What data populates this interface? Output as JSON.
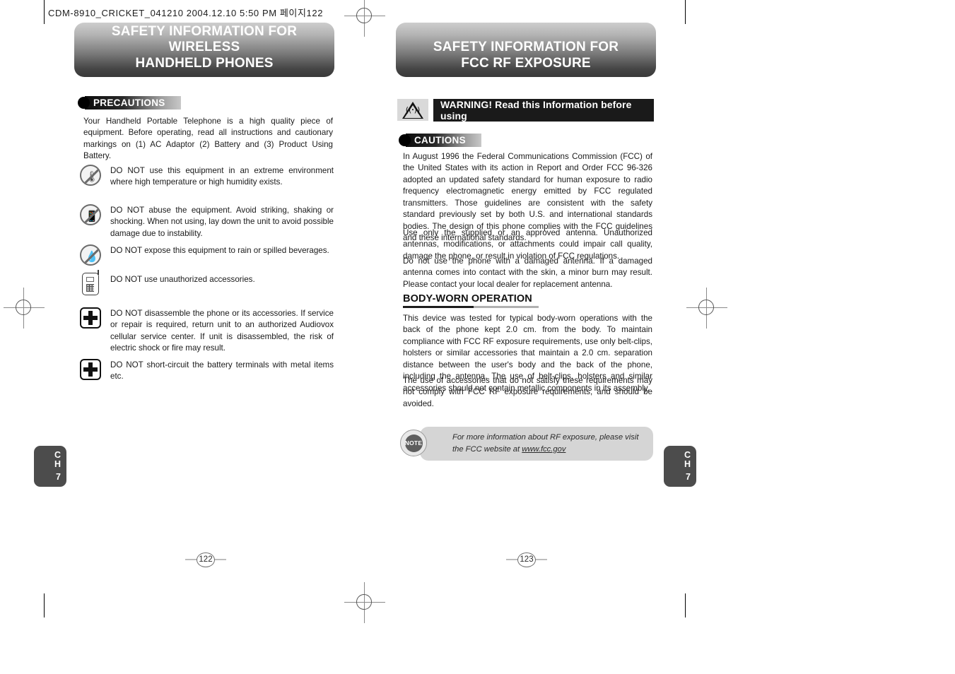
{
  "print_header": "CDM-8910_CRICKET_041210  2004.12.10 5:50 PM  페이지122",
  "left_page": {
    "banner_title": "SAFETY INFORMATION FOR WIRELESS\nHANDHELD PHONES",
    "section_badge": "PRECAUTIONS",
    "intro": "Your Handheld Portable Telephone is a high quality piece of equipment.  Before operating, read all instructions and cautionary markings on (1) AC Adaptor (2) Battery and (3) Product Using Battery.",
    "items": [
      {
        "icon": "no-heat-humidity-icon",
        "text": "DO NOT use this equipment in an extreme environment where high temperature or high humidity exists."
      },
      {
        "icon": "no-impact-icon",
        "text": "DO NOT abuse the equipment.  Avoid striking, shaking or shocking.  When not using, lay down the unit to avoid possible damage due to instability."
      },
      {
        "icon": "no-water-icon",
        "text": "DO NOT expose this equipment to rain or spilled beverages."
      },
      {
        "icon": "phone-accessory-icon",
        "text": "DO NOT use unauthorized accessories."
      },
      {
        "icon": "no-disassemble-icon",
        "text": "DO NOT disassemble the phone or its accessories.  If service or repair is required, return unit to an authorized Audiovox cellular service center.  If unit is disassembled, the risk of electric shock or fire may result."
      },
      {
        "icon": "no-short-circuit-icon",
        "text": "DO NOT short-circuit the battery terminals with metal items etc."
      }
    ],
    "chapter_tab": {
      "letters": "C\nH",
      "number": "7"
    },
    "folio": "122"
  },
  "right_page": {
    "banner_title": "SAFETY INFORMATION FOR\nFCC RF EXPOSURE",
    "warning_bar": "WARNING! Read this Information before using",
    "section_badge": "CAUTIONS",
    "paragraphs": [
      "In August 1996 the Federal Communications Commission (FCC) of the United States with its action in Report and Order FCC 96-326 adopted an updated safety standard for human exposure to radio frequency electromagnetic energy emitted by FCC regulated transmitters. Those guidelines are consistent with the safety standard previously set by both U.S. and international standards bodies. The design of this phone complies with the FCC guidelines and these international standards.",
      "Use only the supplied or an approved antenna. Unauthorized antennas, modifications, or attachments could impair call quality, damage the phone, or result in violation of FCC regulations.",
      "Do not use the phone with a damaged antenna. If a damaged antenna comes into contact with the skin, a minor burn may result. Please contact your local dealer for replacement antenna."
    ],
    "subheading": "BODY-WORN OPERATION",
    "body_worn_paragraphs": [
      "This device was tested for typical body-worn operations with the back of the phone kept 2.0 cm. from the body. To maintain compliance with FCC RF exposure requirements, use only belt-clips, holsters or similar accessories that maintain a 2.0 cm. separation distance between the user's body and the back of the phone, including the antenna. The use of belt-clips, holsters and similar accessories should not contain metallic components in its assembly.",
      "The use of accessories that do not satisfy these requirements may not comply with FCC RF exposure requirements, and should be avoided."
    ],
    "note": {
      "icon_label": "NOTE",
      "text_before": "For more information about RF exposure, please visit the FCC website at ",
      "link": "www.fcc.gov"
    },
    "chapter_tab": {
      "letters": "C\nH",
      "number": "7"
    },
    "folio": "123"
  }
}
